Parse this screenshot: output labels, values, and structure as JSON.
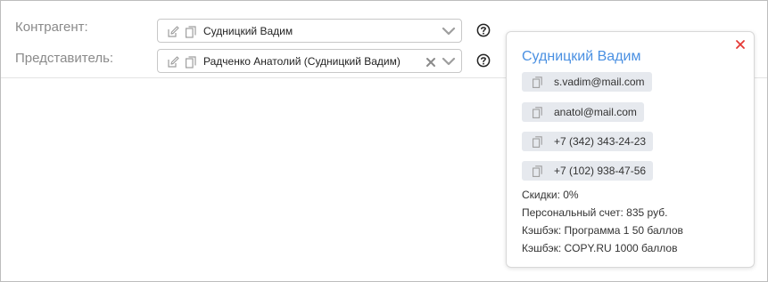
{
  "form": {
    "counterparty": {
      "label": "Контрагент:",
      "value": "Судницкий Вадим",
      "icons": [
        "edit-icon",
        "copy-icon",
        "chevron-down-icon"
      ]
    },
    "representative": {
      "label": "Представитель:",
      "value": "Радченко Анатолий (Судницкий Вадим)",
      "icons": [
        "edit-icon",
        "copy-icon",
        "clear-icon",
        "chevron-down-icon"
      ]
    },
    "help_icon": "question-circle-icon"
  },
  "popover": {
    "name": "Судницкий Вадим",
    "close_icon": "close-icon",
    "contacts": [
      {
        "value": "s.vadim@mail.com",
        "icon": "copy-icon"
      },
      {
        "value": "anatol@mail.com",
        "icon": "copy-icon"
      },
      {
        "value": "+7 (342) 343-24-23",
        "icon": "copy-icon"
      },
      {
        "value": "+7 (102) 938-47-56",
        "icon": "copy-icon"
      }
    ],
    "info": [
      "Скидки: 0%",
      "Персональный счет: 835 руб.",
      "Кэшбэк: Программа 1 50 баллов",
      "Кэшбэк: COPY.RU 1000 баллов"
    ]
  },
  "colors": {
    "accent": "#4a90e2",
    "close": "#e53935",
    "chip_bg": "#e6e9ee"
  }
}
